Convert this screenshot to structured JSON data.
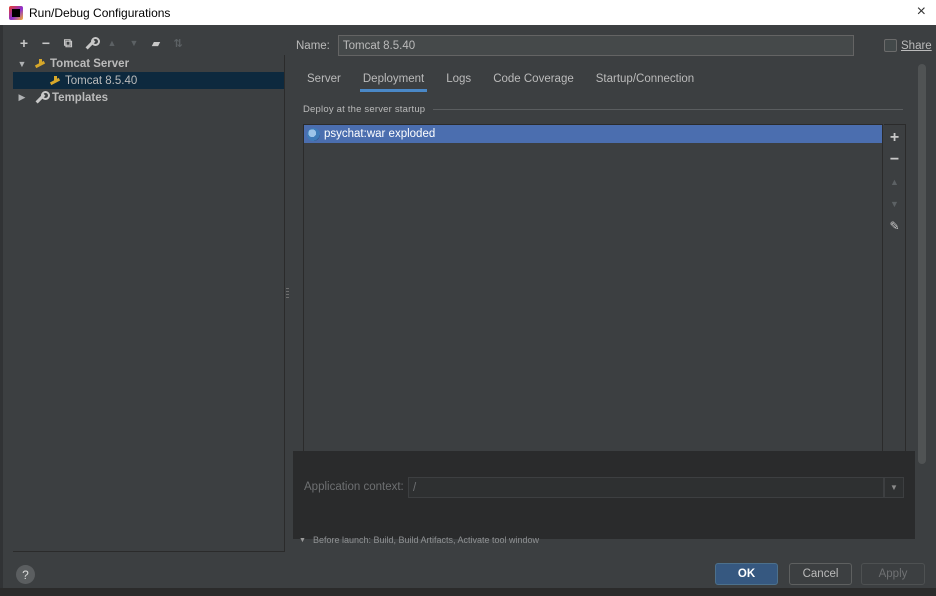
{
  "window": {
    "title": "Run/Debug Configurations",
    "close_glyph": "×"
  },
  "left_toolbar": {
    "icons": [
      "add-icon",
      "remove-icon",
      "copy-icon",
      "wrench-icon",
      "move-up-icon",
      "move-down-icon",
      "folder-icon",
      "sort-icon"
    ]
  },
  "tree": {
    "group_label": "Tomcat Server",
    "config_label": "Tomcat 8.5.40",
    "templates_label": "Templates"
  },
  "name_field": {
    "label": "Name:",
    "value": "Tomcat 8.5.40"
  },
  "share": {
    "label": "Share",
    "checked": false
  },
  "tabs": [
    {
      "label": "Server"
    },
    {
      "label": "Deployment"
    },
    {
      "label": "Logs"
    },
    {
      "label": "Code Coverage"
    },
    {
      "label": "Startup/Connection"
    }
  ],
  "active_tab": "Deployment",
  "deployment": {
    "section_title": "Deploy at the server startup",
    "items": [
      {
        "label": "psychat:war exploded"
      }
    ],
    "side_buttons": [
      "add-icon",
      "remove-icon",
      "move-up-icon",
      "move-down-icon",
      "edit-icon"
    ]
  },
  "app_context": {
    "label": "Application context:",
    "value": "/"
  },
  "before_launch": {
    "text": "Before launch: Build, Build Artifacts, Activate tool window"
  },
  "buttons": {
    "help": "?",
    "ok": "OK",
    "cancel": "Cancel",
    "apply": "Apply"
  },
  "colors": {
    "background": "#3c3f41",
    "selection": "#4b6eaf",
    "tree_selection": "#0d293e",
    "tab_underline": "#4a88c7",
    "ok_button": "#365880"
  }
}
